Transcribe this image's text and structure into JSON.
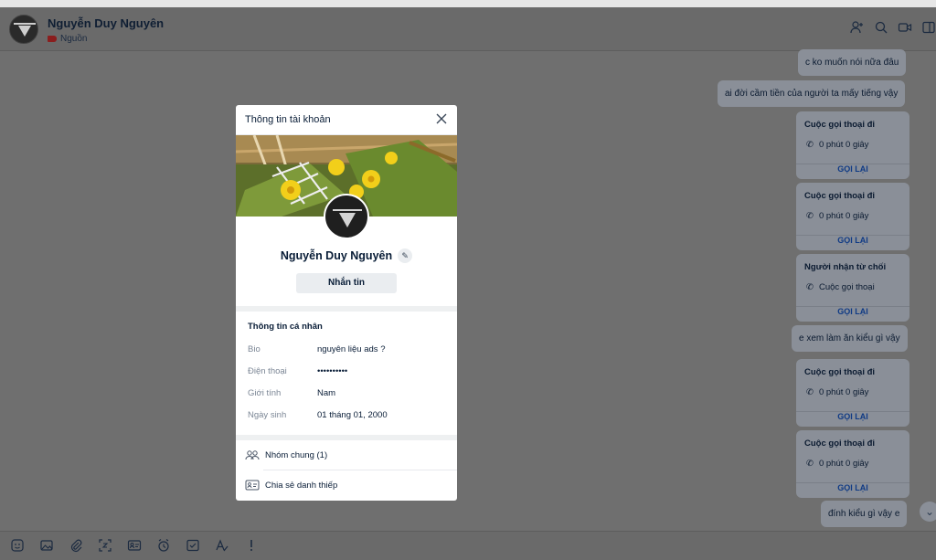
{
  "header": {
    "contact_name": "Nguyễn Duy Nguyên",
    "tag_label": "Nguồn"
  },
  "messages": [
    {
      "kind": "text",
      "text": "c ko muốn nói nữa đâu"
    },
    {
      "kind": "text",
      "text": "ai đời cầm tiền của người ta mấy tiếng vậy"
    },
    {
      "kind": "call",
      "title": "Cuộc gọi thoại đi",
      "detail": "0 phút 0 giây",
      "action": "GỌI LẠI"
    },
    {
      "kind": "call",
      "title": "Cuộc gọi thoại đi",
      "detail": "0 phút 0 giây",
      "action": "GỌI LẠI"
    },
    {
      "kind": "call",
      "title": "Người nhận từ chối",
      "detail": "Cuộc gọi thoại",
      "action": "GỌI LẠI"
    },
    {
      "kind": "text",
      "text": "e xem làm ăn kiểu gì vậy"
    },
    {
      "kind": "call",
      "title": "Cuộc gọi thoại đi",
      "detail": "0 phút 0 giây",
      "action": "GỌI LẠI"
    },
    {
      "kind": "call",
      "title": "Cuộc gọi thoại đi",
      "detail": "0 phút 0 giây",
      "action": "GỌI LẠI"
    },
    {
      "kind": "text",
      "text": "đính kiểu gì vậy e"
    }
  ],
  "modal": {
    "title": "Thông tin tài khoản",
    "profile_name": "Nguyễn Duy Nguyên",
    "message_button": "Nhắn tin",
    "section_title": "Thông tin cá nhân",
    "info": [
      {
        "label": "Bio",
        "value": "nguyên liệu ads ?"
      },
      {
        "label": "Điện thoại",
        "value": "••••••••••"
      },
      {
        "label": "Giới tính",
        "value": "Nam"
      },
      {
        "label": "Ngày sinh",
        "value": "01 tháng 01, 2000"
      }
    ],
    "actions": [
      {
        "label": "Nhóm chung (1)"
      },
      {
        "label": "Chia sẻ danh thiếp"
      }
    ]
  },
  "colors": {
    "overlay": "#6f6f6f",
    "bubble": "#8a8f98",
    "link": "#0f3a85",
    "tag": "#8a1e1e"
  }
}
